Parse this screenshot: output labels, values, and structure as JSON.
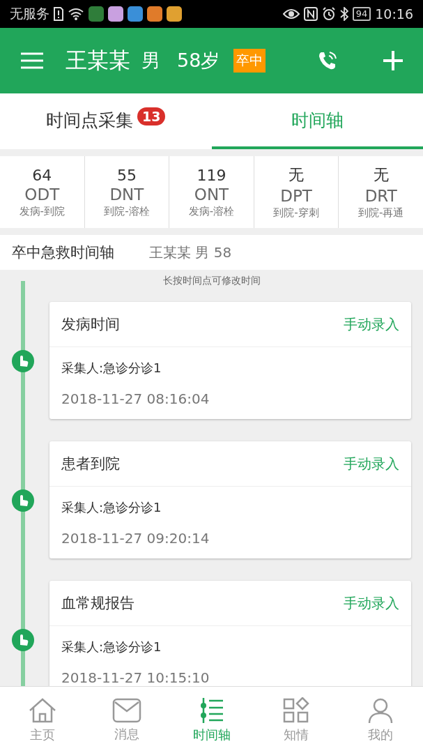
{
  "status_bar": {
    "carrier": "无服务",
    "battery": "94",
    "time": "10:16"
  },
  "header": {
    "name": "王某某",
    "sex": "男",
    "age": "58岁",
    "tag": "卒中"
  },
  "tabs": [
    {
      "label": "时间点采集",
      "badge": "13",
      "selected": false
    },
    {
      "label": "时间轴",
      "selected": true
    }
  ],
  "metrics": [
    {
      "value": "64",
      "code": "ODT",
      "desc": "发病-到院"
    },
    {
      "value": "55",
      "code": "DNT",
      "desc": "到院-溶栓"
    },
    {
      "value": "119",
      "code": "ONT",
      "desc": "发病-溶栓"
    },
    {
      "value": "无",
      "code": "DPT",
      "desc": "到院-穿刺"
    },
    {
      "value": "无",
      "code": "DRT",
      "desc": "到院-再通"
    }
  ],
  "section": {
    "title": "卒中急救时间轴",
    "patient": "王某某 男 58"
  },
  "hint": "长按时间点可修改时间",
  "events": [
    {
      "title": "发病时间",
      "action": "手动录入",
      "collector": "采集人:急诊分诊1",
      "time": "2018-11-27 08:16:04"
    },
    {
      "title": "患者到院",
      "action": "手动录入",
      "collector": "采集人:急诊分诊1",
      "time": "2018-11-27 09:20:14"
    },
    {
      "title": "血常规报告",
      "action": "手动录入",
      "collector": "采集人:急诊分诊1",
      "time": "2018-11-27 10:15:10"
    }
  ],
  "nav": [
    {
      "label": "主页",
      "kind": "home",
      "selected": false
    },
    {
      "label": "消息",
      "kind": "mail",
      "selected": false
    },
    {
      "label": "时间轴",
      "kind": "timeline",
      "selected": true
    },
    {
      "label": "知情",
      "kind": "grid",
      "selected": false
    },
    {
      "label": "我的",
      "kind": "user",
      "selected": false
    }
  ]
}
